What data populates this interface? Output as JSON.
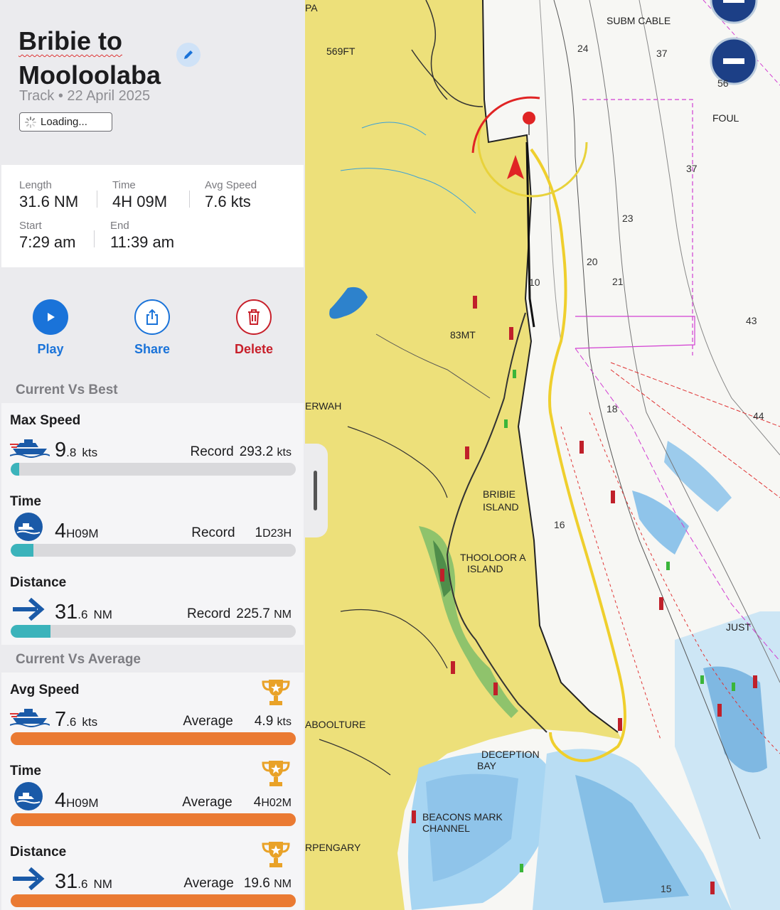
{
  "header": {
    "title_line1": "Bribie to",
    "title_line2": "Mooloolaba",
    "subtitle": "Track • 22 April 2025",
    "loading_label": "Loading..."
  },
  "stats": {
    "length": {
      "label": "Length",
      "value": "31.6 NM"
    },
    "time": {
      "label": "Time",
      "value": "4H 09M"
    },
    "avg_speed": {
      "label": "Avg Speed",
      "value": "7.6 kts"
    },
    "start": {
      "label": "Start",
      "value": "7:29 am"
    },
    "end": {
      "label": "End",
      "value": "11:39 am"
    }
  },
  "actions": {
    "play": "Play",
    "share": "Share",
    "delete": "Delete"
  },
  "colors": {
    "play": "#1a73d9",
    "share": "#1a73d9",
    "delete": "#c8202b",
    "teal": "#3bb3bb",
    "orange": "#ea7a33"
  },
  "current_vs_best": {
    "heading": "Current Vs Best",
    "items": [
      {
        "title": "Max Speed",
        "int": "9",
        "frac": ".8",
        "unit": "kts",
        "record_label": "Record",
        "record_int": "293.2",
        "record_unit": "kts",
        "progress": 0.03,
        "icon": "boat-speed-icon"
      },
      {
        "title": "Time",
        "int": "4",
        "frac": "H09",
        "unit": "M",
        "record_label": "Record",
        "record_int": "1",
        "record_unit": "D23H",
        "progress": 0.08,
        "icon": "boat-time-icon"
      },
      {
        "title": "Distance",
        "int": "31",
        "frac": ".6",
        "unit": "NM",
        "record_label": "Record",
        "record_int": "225.7",
        "record_unit": "NM",
        "progress": 0.14,
        "icon": "arrow-right-icon"
      }
    ]
  },
  "current_vs_average": {
    "heading": "Current Vs Average",
    "items": [
      {
        "title": "Avg Speed",
        "int": "7",
        "frac": ".6",
        "unit": "kts",
        "avg_label": "Average",
        "avg_int": "4.9",
        "avg_unit": "kts",
        "icon": "boat-speed-icon"
      },
      {
        "title": "Time",
        "int": "4",
        "frac": "H09",
        "unit": "M",
        "avg_label": "Average",
        "avg_int": "4",
        "avg_unit": "H02M",
        "icon": "boat-time-icon"
      },
      {
        "title": "Distance",
        "int": "31",
        "frac": ".6",
        "unit": "NM",
        "avg_label": "Average",
        "avg_int": "19.6",
        "avg_unit": "NM",
        "icon": "arrow-right-icon"
      }
    ]
  },
  "map_labels": {
    "subm_cable": "SUBM CABLE",
    "foul": "FOUL",
    "ft569": "569FT",
    "mt83": "83MT",
    "erwah": "ERWAH",
    "bribie1": "BRIBIE",
    "bribie2": "ISLAND",
    "thoo1": "THOOLOOR A",
    "thoo2": "ISLAND",
    "aboolture": "ABOOLTURE",
    "deception1": "DECEPTION",
    "deception2": "BAY",
    "beacons1": "BEACONS MARK",
    "beacons2": "CHANNEL",
    "pengary": "RPENGARY",
    "pa": "PA",
    "just": "JUST",
    "d24": "24",
    "d37a": "37",
    "d37b": "37",
    "d23": "23",
    "d20": "20",
    "d21": "21",
    "d43": "43",
    "d44": "44",
    "d18": "18",
    "d10": "10",
    "d16": "16",
    "d15": "15",
    "d56": "56"
  }
}
